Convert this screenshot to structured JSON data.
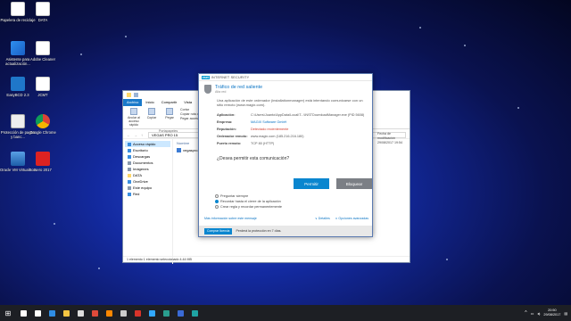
{
  "desktop": {
    "icons": [
      {
        "label": "Papelera de reciclaje"
      },
      {
        "label": "DATA"
      },
      {
        "label": "Asistente para actualización..."
      },
      {
        "label": "Adobe Cleaner"
      },
      {
        "label": "EasyBCD 2.3"
      },
      {
        "label": "JCMT"
      },
      {
        "label": "Protección de pagos y banc..."
      },
      {
        "label": "Google Chrome"
      },
      {
        "label": "Oracle VM VirtualBox"
      },
      {
        "label": "Nero 2017"
      }
    ]
  },
  "explorer": {
    "ribbon_tabs": [
      "Archivo",
      "Inicio",
      "Compartir",
      "Vista"
    ],
    "ribbon_buttons": [
      "Anclar al acceso rápido",
      "Copiar",
      "Pegar"
    ],
    "ribbon_small": [
      "Cortar",
      "Copiar ruta de acceso",
      "Pegar acceso directo"
    ],
    "group_label": "Portapapeles",
    "path": "VEGAS PRO 15",
    "nav": [
      {
        "label": "Acceso rápido",
        "type": "blue",
        "selected": true
      },
      {
        "label": "Escritorio",
        "type": "blue"
      },
      {
        "label": "Descargas",
        "type": "blue"
      },
      {
        "label": "Documentos",
        "type": "gray"
      },
      {
        "label": "Imágenes",
        "type": "gray"
      },
      {
        "label": "DATA",
        "type": "folder"
      },
      {
        "label": "OneDrive",
        "type": "blue"
      },
      {
        "label": "Este equipo",
        "type": "gray"
      },
      {
        "label": "Red",
        "type": "blue"
      }
    ],
    "files_header": "Nombre",
    "files": [
      "vegaspro..."
    ],
    "preview": [
      "Fecha de modificación",
      "29/08/2017 19:54"
    ],
    "status": "1 elemento     1 elemento seleccionado  4.44 MB"
  },
  "eset": {
    "brand": "INTERNET SECURITY",
    "logo": "eset",
    "title": "Tráfico de red saliente",
    "subtitle": "Alta red",
    "description": "Una aplicación de este ordenador (installationmanager) está intentando comunicarse con un sitio remoto (www.magix.com).",
    "details": [
      {
        "key": "Aplicación:",
        "value": "C:\\Users\\Juanto\\AppData\\Local\\T...\\INSTDownloadManager.exe (PID 5608)",
        "style": "normal"
      },
      {
        "key": "Empresa:",
        "value": "MAGIX Software GmbH",
        "style": "link"
      },
      {
        "key": "Reputación:",
        "value": "Detectado recientemente",
        "style": "warn"
      },
      {
        "key": "Ordenador remoto:",
        "value": "www.magix.com (185.216.216.180)",
        "style": "normal"
      },
      {
        "key": "Puerto remoto:",
        "value": "TCP 80 (HTTP)",
        "style": "normal"
      }
    ],
    "question": "¿Desea permitir esta comunicación?",
    "allow_label": "Permitir",
    "deny_label": "Bloquear",
    "options": [
      {
        "label": "Preguntar siempre",
        "selected": false
      },
      {
        "label": "Recordar hasta el cierre de la aplicación",
        "selected": true
      },
      {
        "label": "Crear regla y recordar permanentemente",
        "selected": false
      }
    ],
    "more_info": "Más información sobre este mensaje",
    "details_toggle": "∨ Detalles",
    "advanced_options": "∨ Opciones avanzadas",
    "protection_button": "Comprar licencia",
    "protection_text": "Perderá la protección en 7 días."
  },
  "taskbar": {
    "time": "20:50",
    "date": "29/08/2017",
    "start_glyph": "⊞",
    "apps": [
      {
        "name": "search",
        "color": "#ffffff"
      },
      {
        "name": "task-view",
        "color": "#ffffff"
      },
      {
        "name": "edge",
        "color": "#2f8de4"
      },
      {
        "name": "explorer",
        "color": "#f4c542"
      },
      {
        "name": "store",
        "color": "#dddddd"
      },
      {
        "name": "chrome",
        "color": "#e04a3a"
      },
      {
        "name": "vlc",
        "color": "#ff8800"
      },
      {
        "name": "calc",
        "color": "#cccccc"
      },
      {
        "name": "app-red",
        "color": "#d8342a"
      },
      {
        "name": "photoshop",
        "color": "#31a8ff"
      },
      {
        "name": "vegas",
        "color": "#2a9d8f"
      },
      {
        "name": "app-blue",
        "color": "#3a6ad6"
      },
      {
        "name": "app-teal",
        "color": "#1fa3a3"
      }
    ]
  }
}
